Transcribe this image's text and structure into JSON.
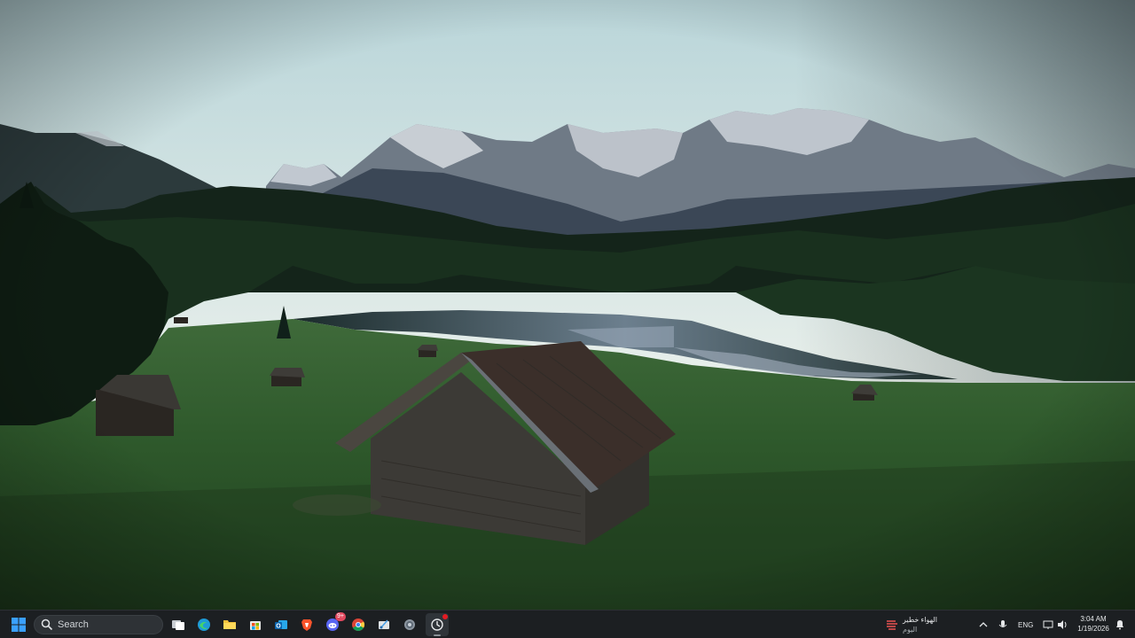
{
  "taskbar": {
    "search_label": "Search",
    "pinned_icons": [
      "task-view-icon",
      "edge-icon",
      "file-explorer-icon",
      "microsoft-store-icon",
      "outlook-icon",
      "brave-icon",
      "discord-icon",
      "chrome-icon",
      "snipping-tool-icon",
      "settings-icon",
      "app-icon"
    ],
    "discord_badge": "9+",
    "news_widget": {
      "headline": "الهواء خطير",
      "subtitle": "اليوم"
    },
    "tray": {
      "language": "ENG"
    },
    "clock": {
      "time": "3:04 AM",
      "date": "1/19/2026"
    }
  },
  "colors": {
    "taskbar_bg": "#1c1f22",
    "accent": "#0078d4",
    "badge": "#e2485f"
  }
}
